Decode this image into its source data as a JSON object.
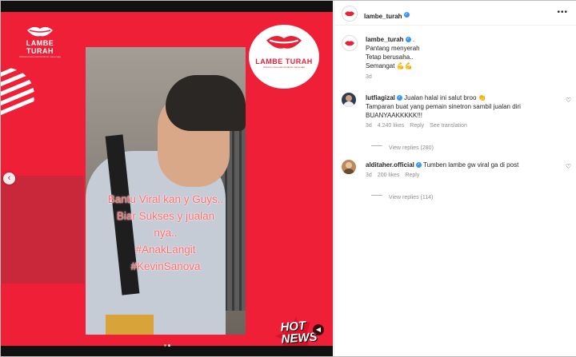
{
  "media": {
    "brand_name": "LAMBE TURAH",
    "brand_tagline": "Hiburan menemani Anda ke mana saja",
    "overlay_lines": [
      "Bantu Viral kan y Guys..",
      "Biar Sukses y jualan",
      "nya..",
      "#AnakLangit",
      "#KevinSanova"
    ],
    "badge_line1": "HOT",
    "badge_line2": "NEWS",
    "prev_icon": "chevron-left-icon",
    "sound_icon": "speaker-muted-icon",
    "slide_count": 2,
    "active_slide": 2,
    "accent_color": "#ee1f36"
  },
  "header": {
    "username": "lambe_turah",
    "more_label": "•••"
  },
  "caption": {
    "username": "lambe_turah",
    "suffix": ".",
    "lines": [
      "Pantang menyerah",
      "Tetap berusaha..",
      "Semangat 💪💪"
    ],
    "time": "3d"
  },
  "comments": [
    {
      "username": "lutfiagizal",
      "text_lines": [
        "Jualan halal ini salut broo 👏",
        "Tamparan buat yang pemain sinetron sambil jualan diri",
        "BUANYAAKKKKK!!!"
      ],
      "time": "3d",
      "likes": "4.240 likes",
      "reply": "Reply",
      "see_translation": "See translation",
      "view_replies": "View replies (280)"
    },
    {
      "username": "alditaher.official",
      "text_lines": [
        "Tumben lambe gw viral ga di post"
      ],
      "time": "3d",
      "likes": "200 likes",
      "reply": "Reply",
      "view_replies": "View replies (114)"
    }
  ]
}
